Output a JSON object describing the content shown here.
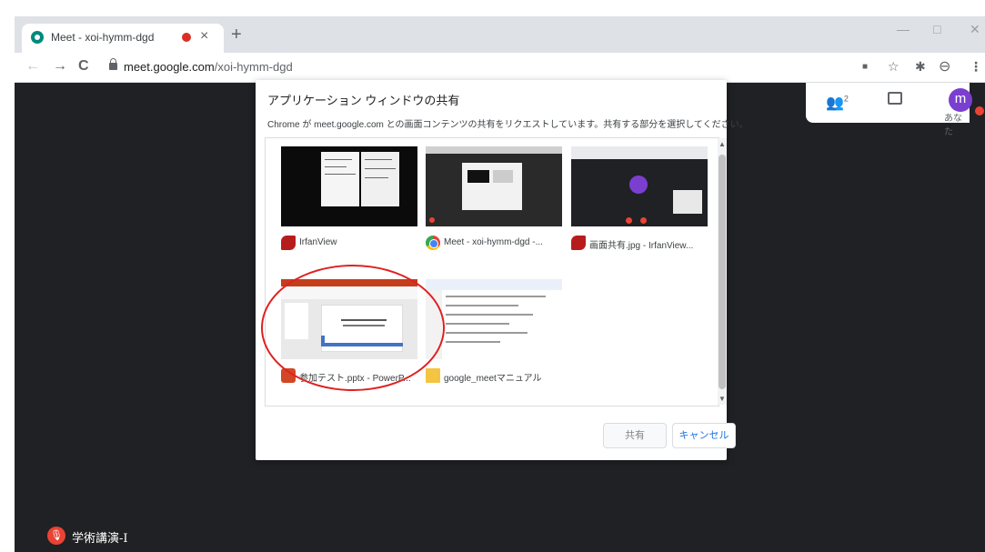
{
  "tab": {
    "title": "Meet - xoi-hymm-dgd",
    "close": "×"
  },
  "newtab": "+",
  "window_controls": {
    "minimize": "—",
    "maximize": "□",
    "close": "✕"
  },
  "nav": {
    "back": "←",
    "forward": "→",
    "reload": "C"
  },
  "omnibox": {
    "host": "meet.google.com",
    "path": "/xoi-hymm-dgd"
  },
  "toolbar_icons": {
    "camera": "■",
    "star": "☆",
    "extensions": "✱",
    "profile": "⊖",
    "menu": "⋮"
  },
  "meet": {
    "people_count": "2",
    "avatar_letter": "m",
    "you_label": "あなた",
    "participant_name": "学術講演-I"
  },
  "dialog": {
    "title": "アプリケーション ウィンドウの共有",
    "description": "Chrome が meet.google.com との画面コンテンツの共有をリクエストしています。共有する部分を選択してください。",
    "windows": [
      {
        "label": "IrfanView",
        "icon": "irfanview-icon"
      },
      {
        "label": "Meet - xoi-hymm-dgd -...",
        "icon": "chrome-icon"
      },
      {
        "label": "画面共有.jpg - IrfanView...",
        "icon": "irfanview-icon"
      },
      {
        "label": "参加テスト.pptx - PowerP...",
        "icon": "powerpoint-icon"
      },
      {
        "label": "google_meetマニュアル",
        "icon": "folder-icon"
      }
    ],
    "share_button": "共有",
    "cancel_button": "キャンセル"
  },
  "colors": {
    "meet_bg": "#202124",
    "highlight": "#e02020",
    "accent": "#1a73e8"
  }
}
